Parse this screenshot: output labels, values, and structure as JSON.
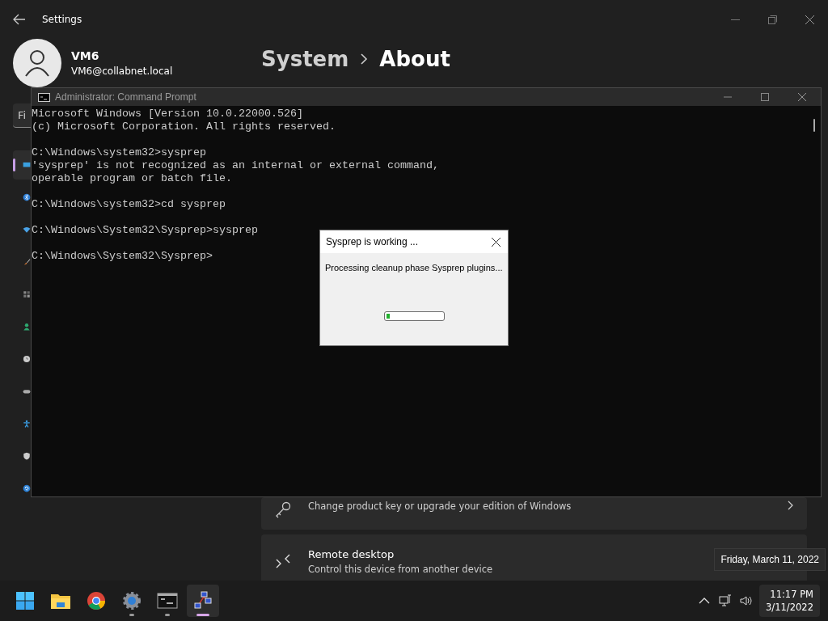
{
  "settings": {
    "title": "Settings",
    "user": {
      "name": "VM6",
      "email": "VM6@collabnet.local"
    },
    "breadcrumb": [
      "System",
      "About"
    ],
    "search": {
      "placeholder": "Fi"
    },
    "sidebar": [
      {
        "kind": "display",
        "selected": true
      },
      {
        "kind": "bluetooth",
        "selected": false
      },
      {
        "kind": "wifi",
        "selected": false
      },
      {
        "kind": "brush",
        "selected": false
      },
      {
        "kind": "apps",
        "selected": false
      },
      {
        "kind": "accounts",
        "selected": false
      },
      {
        "kind": "clock",
        "selected": false
      },
      {
        "kind": "gaming",
        "selected": false
      },
      {
        "kind": "accessibility",
        "selected": false
      },
      {
        "kind": "shield",
        "selected": false
      },
      {
        "kind": "update",
        "selected": false
      }
    ],
    "cards": [
      {
        "kind": "key",
        "subtitle": "Change product key or upgrade your edition of Windows",
        "chevron": true
      },
      {
        "kind": "remote",
        "title": "Remote desktop",
        "subtitle": "Control this device from another device"
      }
    ]
  },
  "console": {
    "title": "Administrator: Command Prompt",
    "blocks": [
      [
        "Microsoft Windows [Version 10.0.22000.526]",
        "(c) Microsoft Corporation. All rights reserved."
      ],
      [
        "C:\\Windows\\system32>sysprep",
        "'sysprep' is not recognized as an internal or external command,",
        "operable program or batch file."
      ],
      [
        "C:\\Windows\\system32>cd sysprep"
      ],
      [
        "C:\\Windows\\System32\\Sysprep>sysprep"
      ],
      [
        "C:\\Windows\\System32\\Sysprep>"
      ]
    ]
  },
  "dialog": {
    "title": "Sysprep is working ...",
    "message": "Processing cleanup phase Sysprep plugins...",
    "level": 0.06
  },
  "taskbar": {
    "apps": [
      {
        "kind": "start",
        "running": false,
        "active": false
      },
      {
        "kind": "explorer",
        "running": false,
        "active": false
      },
      {
        "kind": "browser",
        "running": false,
        "active": false
      },
      {
        "kind": "settings",
        "running": true,
        "active": false
      },
      {
        "kind": "terminal",
        "running": true,
        "active": false
      },
      {
        "kind": "network",
        "running": true,
        "active": true
      }
    ],
    "time": "11:17 PM",
    "date": "3/11/2022",
    "tooltip": "Friday, March 11, 2022"
  }
}
